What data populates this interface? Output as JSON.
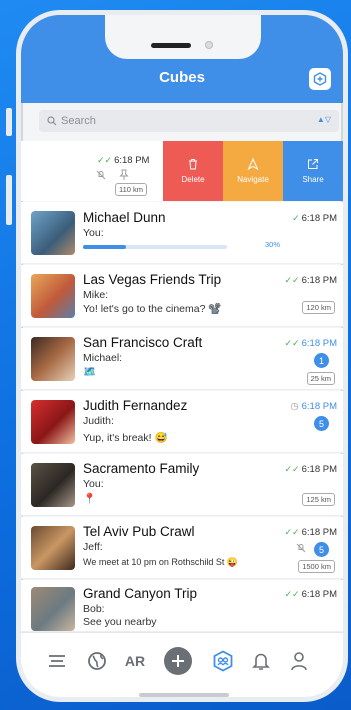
{
  "header": {
    "title": "Cubes",
    "add_icon": "add-cube-icon",
    "accent": "#3f8ee8"
  },
  "search": {
    "placeholder": "Search"
  },
  "swipe_row": {
    "time": "6:18 PM",
    "distance": "110 km",
    "actions": [
      {
        "label": "Delete",
        "icon": "trash-icon",
        "color": "#ee5b55"
      },
      {
        "label": "Navigate",
        "icon": "navigate-icon",
        "color": "#f5a941"
      },
      {
        "label": "Share",
        "icon": "share-icon",
        "color": "#3f8ee8"
      }
    ]
  },
  "chats": [
    {
      "name": "Michael Dunn",
      "sender": "You:",
      "message": "",
      "time": "6:18 PM",
      "progress": 30,
      "progress_label": "30%"
    },
    {
      "name": "Las Vegas Friends Trip",
      "sender": "Mike:",
      "message": "Yo! let's go to the cinema? 📽️",
      "time": "6:18 PM",
      "distance": "120 km"
    },
    {
      "name": "San Francisco Craft",
      "sender": "Michael:",
      "message": "🗺️",
      "time": "6:18 PM",
      "badge": "1",
      "distance": "25 km"
    },
    {
      "name": "Judith Fernandez",
      "sender": "Judith:",
      "message": "Yup, it's break! 😅",
      "time": "6:18 PM",
      "badge": "5"
    },
    {
      "name": "Sacramento Family",
      "sender": "You:",
      "message": "📍",
      "time": "6:18 PM",
      "distance": "125 km"
    },
    {
      "name": "Tel Aviv Pub Crawl",
      "sender": "Jeff:",
      "message": "We meet at 10 pm on Rothschild St 😜",
      "time": "6:18 PM",
      "badge": "5",
      "distance": "1500 km"
    },
    {
      "name": "Grand Canyon Trip",
      "sender": "Bob:",
      "message": "See you nearby",
      "time": "6:18 PM"
    }
  ],
  "bottom_nav": {
    "items": [
      "menu-icon",
      "globe-icon",
      "AR",
      "plus-icon",
      "cubes-icon",
      "bell-icon",
      "profile-icon"
    ],
    "ar_label": "AR"
  }
}
